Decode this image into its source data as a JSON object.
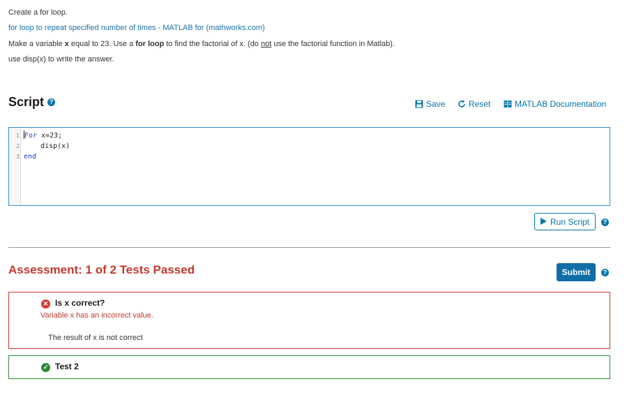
{
  "instructions": {
    "line1": "Create a for loop.",
    "link": "for loop to repeat specified number of times - MATLAB for (mathworks.com)",
    "line3_a": "Make a variable ",
    "line3_b": "x",
    "line3_c": " equal to 23.  Use a ",
    "line3_d": "for loop",
    "line3_e": " to find the factorial of x. (do ",
    "line3_f": "not",
    "line3_g": " use the factorial function in Matlab).",
    "line4": "use disp(x) to write the answer."
  },
  "script": {
    "title": "Script",
    "help_icon": "?",
    "toolbar": {
      "save": "Save",
      "reset": "Reset",
      "documentation": "MATLAB Documentation"
    },
    "code_lines": [
      {
        "number": "1",
        "keyword": "For",
        "rest": " x=23;"
      },
      {
        "number": "2",
        "keyword": "",
        "rest": "    disp(x)"
      },
      {
        "number": "3",
        "keyword": "end",
        "rest": ""
      }
    ],
    "run_label": "Run Script"
  },
  "assessment": {
    "title": "Assessment: 1 of 2 Tests Passed",
    "submit_label": "Submit",
    "tests": [
      {
        "name": "Is x correct?",
        "status": "failed",
        "error": "Variable x has an incorrect value.",
        "message": "The result of x is not correct"
      },
      {
        "name": "Test 2",
        "status": "passed"
      }
    ]
  },
  "colors": {
    "link": "#1a73a8",
    "accent": "#0076a8",
    "fail": "#c0392b",
    "pass": "#2e8b3a",
    "editor_border": "#2f8fd0"
  },
  "icons": {
    "save": "save-icon",
    "reset": "reset-icon",
    "documentation": "documentation-icon",
    "run": "play-icon",
    "fail": "x-circle-icon",
    "pass": "check-circle-icon",
    "help": "question-circle-icon"
  }
}
